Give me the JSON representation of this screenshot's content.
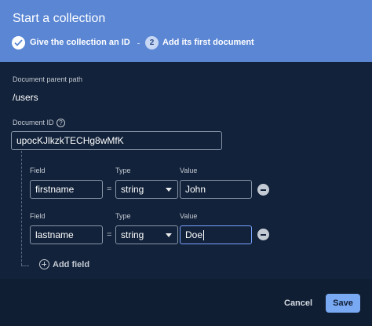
{
  "dialog": {
    "title": "Start a collection",
    "step1": {
      "label": "Give the collection an ID",
      "icon": "check-icon"
    },
    "step2": {
      "number": "2",
      "label": "Add its first document"
    }
  },
  "form": {
    "parent_path_label": "Document parent path",
    "parent_path_value": "/users",
    "document_id_label": "Document ID",
    "document_id_value": "upocKJlkzkTECHg8wMfK",
    "fields": [
      {
        "field_label": "Field",
        "type_label": "Type",
        "value_label": "Value",
        "field": "firstname",
        "equals": "=",
        "type": "string",
        "value": "John"
      },
      {
        "field_label": "Field",
        "type_label": "Type",
        "value_label": "Value",
        "field": "lastname",
        "equals": "=",
        "type": "string",
        "value": "Doe"
      }
    ],
    "add_field_label": "Add field"
  },
  "footer": {
    "cancel_label": "Cancel",
    "save_label": "Save"
  },
  "colors": {
    "header": "#5a86d4",
    "panel": "#12223a",
    "primary_button": "#7aa9f4"
  }
}
